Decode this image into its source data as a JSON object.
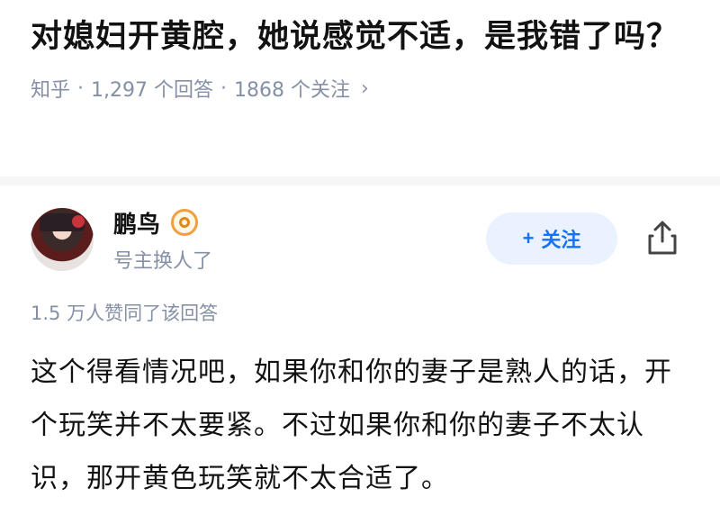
{
  "question": {
    "title": "对媳妇开黄腔，她说感觉不适，是我错了吗？",
    "source": "知乎",
    "answers_count": "1,297 个回答",
    "followers_count": "1868 个关注",
    "chevron": "›"
  },
  "author": {
    "name": "鹏鸟",
    "bio": "号主换人了",
    "badge_icon": "eye-badge-icon",
    "avatar_icon": "avatar"
  },
  "actions": {
    "follow_label": "关注",
    "follow_plus": "+",
    "share_icon": "share-icon"
  },
  "answer": {
    "likes": "1.5 万人赞同了该回答",
    "text": "这个得看情况吧，如果你和你的妻子是熟人的话，开个玩笑并不太要紧。不过如果你和你的妻子不太认识，那开黄色玩笑就不太合适了。"
  },
  "colors": {
    "accent": "#1772f6",
    "accent_bg": "#eaf1ff",
    "meta_gray": "#8590a6",
    "badge_orange": "#f0a03c"
  }
}
